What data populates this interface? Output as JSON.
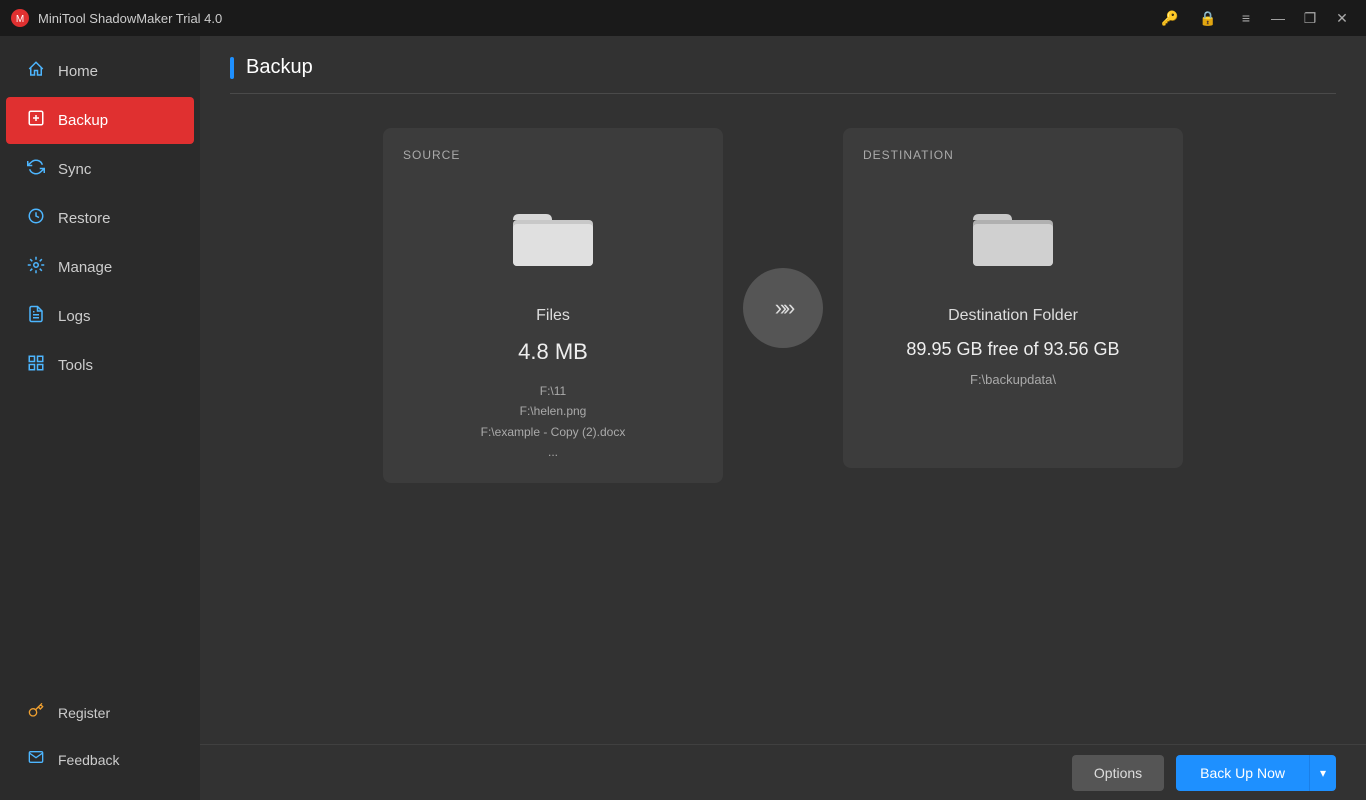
{
  "app": {
    "title": "MiniTool ShadowMaker Trial 4.0"
  },
  "titlebar": {
    "title": "MiniTool ShadowMaker Trial 4.0",
    "controls": {
      "minimize": "—",
      "restore": "❐",
      "close": "✕"
    }
  },
  "sidebar": {
    "items": [
      {
        "id": "home",
        "label": "Home",
        "icon": "🏠"
      },
      {
        "id": "backup",
        "label": "Backup",
        "icon": "🗂"
      },
      {
        "id": "sync",
        "label": "Sync",
        "icon": "🔄"
      },
      {
        "id": "restore",
        "label": "Restore",
        "icon": "⚙"
      },
      {
        "id": "manage",
        "label": "Manage",
        "icon": "⚙"
      },
      {
        "id": "logs",
        "label": "Logs",
        "icon": "📋"
      },
      {
        "id": "tools",
        "label": "Tools",
        "icon": "🔧"
      }
    ],
    "bottom": [
      {
        "id": "register",
        "label": "Register",
        "icon": "🔑"
      },
      {
        "id": "feedback",
        "label": "Feedback",
        "icon": "✉"
      }
    ]
  },
  "page": {
    "title": "Backup"
  },
  "source": {
    "label": "SOURCE",
    "name": "Files",
    "size": "4.8 MB",
    "paths": [
      "F:\\11",
      "F:\\helen.png",
      "F:\\example - Copy (2).docx",
      "..."
    ]
  },
  "destination": {
    "label": "DESTINATION",
    "name": "Destination Folder",
    "free": "89.95 GB free of 93.56 GB",
    "path": "F:\\backupdata\\"
  },
  "buttons": {
    "options": "Options",
    "backupNow": "Back Up Now",
    "dropdownArrow": "▾"
  }
}
